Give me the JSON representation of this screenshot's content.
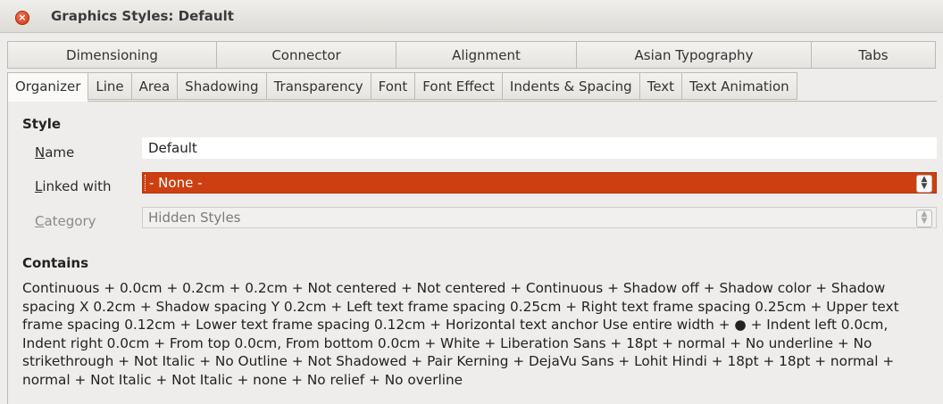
{
  "window": {
    "title": "Graphics Styles: Default"
  },
  "tabs_top": [
    "Dimensioning",
    "Connector",
    "Alignment",
    "Asian Typography",
    "Tabs"
  ],
  "tabs_bottom": [
    "Organizer",
    "Line",
    "Area",
    "Shadowing",
    "Transparency",
    "Font",
    "Font Effect",
    "Indents & Spacing",
    "Text",
    "Text Animation"
  ],
  "active_tab": "Organizer",
  "style": {
    "heading": "Style",
    "name_label": "Name",
    "name_value": "Default",
    "linked_label": "Linked with",
    "linked_value": "- None -",
    "category_label": "Category",
    "category_value": "Hidden Styles"
  },
  "contains": {
    "heading": "Contains",
    "text": "Continuous + 0.0cm + 0.2cm + 0.2cm + Not centered + Not centered + Continuous + Shadow off + Shadow color + Shadow spacing X 0.2cm + Shadow spacing Y 0.2cm + Left text frame spacing 0.25cm + Right text frame spacing 0.25cm + Upper text frame spacing 0.12cm + Lower text frame spacing 0.12cm + Horizontal text anchor Use entire width + ● + Indent left 0.0cm, Indent right 0.0cm + From top 0.0cm, From bottom 0.0cm + White + Liberation Sans + 18pt + normal + No underline + No strikethrough + Not Italic + No Outline + Not Shadowed + Pair Kerning + DejaVu Sans + Lohit Hindi + 18pt + 18pt + normal + normal + Not Italic + Not Italic + none + No relief + No overline"
  },
  "colors": {
    "accent": "#cd3f11",
    "close": "#df4a26"
  }
}
